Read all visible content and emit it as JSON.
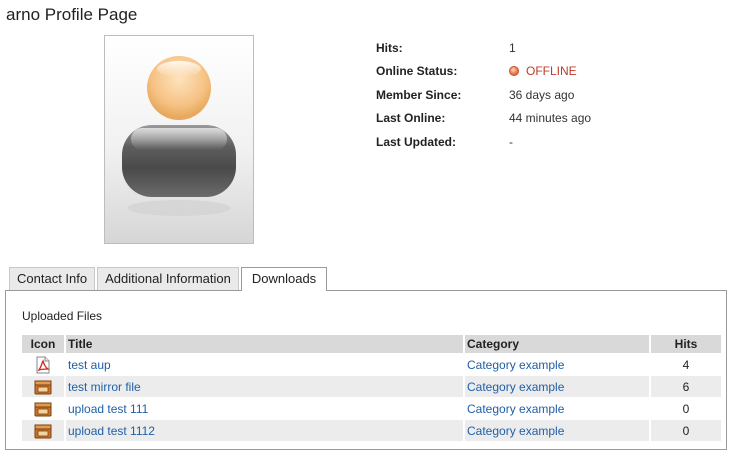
{
  "page": {
    "title": "arno Profile Page"
  },
  "profile": {
    "fields": [
      {
        "label": "Hits:",
        "value": "1"
      },
      {
        "label": "Online Status:",
        "value": "OFFLINE",
        "status_color": "#c0392b"
      },
      {
        "label": "Member Since:",
        "value": "36 days ago"
      },
      {
        "label": "Last Online:",
        "value": "44 minutes ago"
      },
      {
        "label": "Last Updated:",
        "value": "-"
      }
    ]
  },
  "tabs": [
    {
      "label": "Contact Info",
      "active": false
    },
    {
      "label": "Additional Information",
      "active": false
    },
    {
      "label": "Downloads",
      "active": true
    }
  ],
  "downloads": {
    "section_title": "Uploaded Files",
    "columns": [
      "Icon",
      "Title",
      "Category",
      "Hits"
    ],
    "rows": [
      {
        "icon": "pdf-file-icon",
        "title": "test aup",
        "category": "Category example",
        "hits": "4"
      },
      {
        "icon": "archive-file-icon",
        "title": "test mirror file",
        "category": "Category example",
        "hits": "6"
      },
      {
        "icon": "archive-file-icon",
        "title": "upload test 111",
        "category": "Category example",
        "hits": "0"
      },
      {
        "icon": "archive-file-icon",
        "title": "upload test 1112",
        "category": "Category example",
        "hits": "0"
      }
    ]
  }
}
